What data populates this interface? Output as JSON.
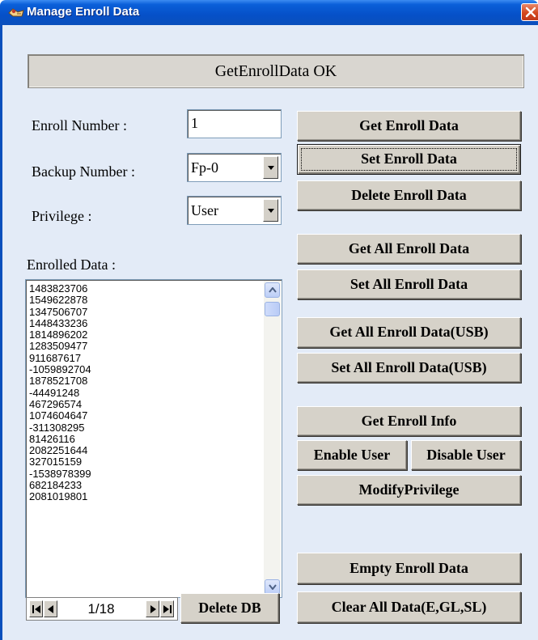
{
  "window": {
    "title": "Manage Enroll Data",
    "icon": "app-icon",
    "close_icon": "close-icon"
  },
  "status": {
    "text": "GetEnrollData OK"
  },
  "form": {
    "enroll_number_label": "Enroll Number :",
    "enroll_number_value": "1",
    "backup_number_label": "Backup Number :",
    "backup_number_value": "Fp-0",
    "privilege_label": "Privilege :",
    "privilege_value": "User",
    "enrolled_data_label": "Enrolled Data :"
  },
  "enrolled_data": [
    "1483823706",
    "1549622878",
    "1347506707",
    "1448433236",
    "1814896202",
    "1283509477",
    "911687617",
    "-1059892704",
    "1878521708",
    "-44491248",
    "467296574",
    "1074604647",
    "-311308295",
    "81426116",
    "2082251644",
    "327015159",
    "-1538978399",
    "682184233",
    "2081019801"
  ],
  "navigator": {
    "page": "1/18",
    "icons": [
      "first-icon",
      "prev-icon",
      "next-icon",
      "last-icon"
    ]
  },
  "buttons": {
    "get_enroll_data": "Get Enroll Data",
    "set_enroll_data": "Set Enroll Data",
    "delete_enroll_data": "Delete Enroll Data",
    "get_all_enroll_data": "Get All Enroll Data",
    "set_all_enroll_data": "Set All Enroll Data",
    "get_all_enroll_data_usb": "Get All Enroll Data(USB)",
    "set_all_enroll_data_usb": "Set All Enroll Data(USB)",
    "get_enroll_info": "Get Enroll Info",
    "enable_user": "Enable User",
    "disable_user": "Disable User",
    "modify_privilege": "ModifyPrivilege",
    "empty_enroll_data": "Empty Enroll Data",
    "clear_all_data": "Clear All Data(E,GL,SL)",
    "delete_db": "Delete DB"
  },
  "colors": {
    "titlebar": "#0650c8",
    "client_background": "#e3ebf7",
    "button_face": "#d6d2c9",
    "close_button": "#d4471d"
  }
}
